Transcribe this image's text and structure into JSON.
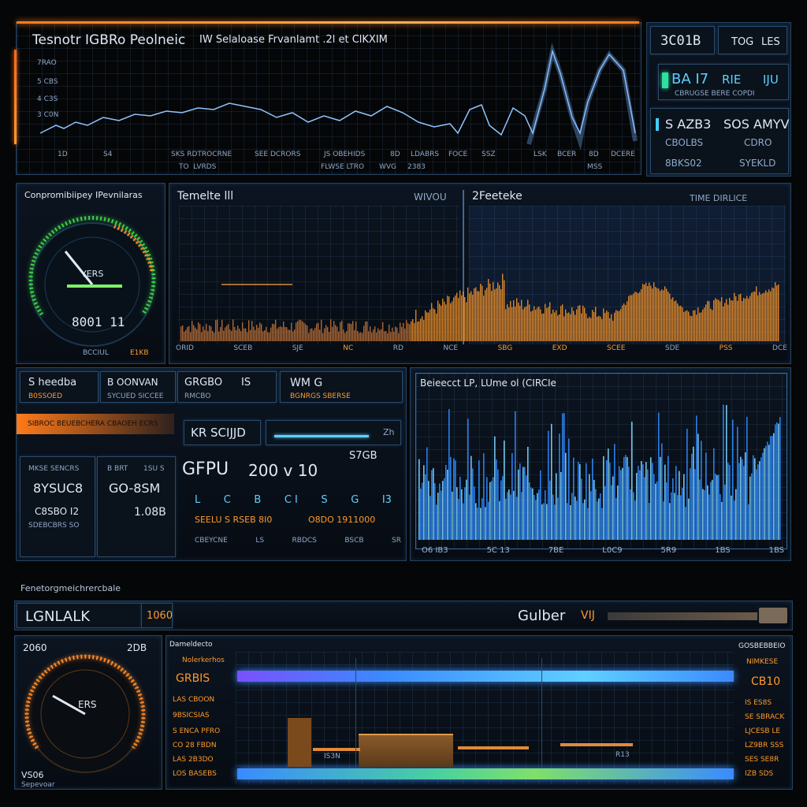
{
  "top": {
    "title": "Tesnotr IGBRo Peolneic",
    "title_tail": "IW Selaloase Frvanlamt .2l et ClKXIM",
    "y_labels": [
      "7RAO",
      "5 CBS",
      "4 C3S",
      "3 C0N"
    ],
    "x_labels": [
      "1D",
      "S4",
      "SKS RDTROCRNE",
      "SEE DCRORS",
      "JS OBEHIDS",
      "8D",
      "LDABRS",
      "FOCE",
      "SSZ",
      "LSK",
      "BCER",
      "8D",
      "DCERE"
    ],
    "x_sub": [
      "TO  LVRDS",
      "FLWSE LTRO",
      "WVG",
      "2383",
      "MSS"
    ],
    "series": [
      {
        "name": "baseline",
        "color": "#7fb8ff"
      },
      {
        "name": "peaks",
        "color": "#a8c8ff"
      }
    ]
  },
  "stats": {
    "a_value": "3C01B",
    "b_label": "TOG",
    "b_sub": "LES",
    "row2_a": "BA I7",
    "row2_b": "RIE",
    "row2_c": "IJU",
    "row2_sub": "CBRUGSE BERE COPDI",
    "row3_a": "S AZB3",
    "row3_b": "SOS AMYV",
    "row3_c": "CBOLBS",
    "row3_d": "CDRO",
    "row3_e": "8BKS02",
    "row3_f": "SYEKLD"
  },
  "gauge1": {
    "header": "Conpromibiipey IPevnilaras",
    "value": "8001 11",
    "inner": "YERS",
    "foot_a": "BCCIUL",
    "foot_b": "E1KB"
  },
  "chart_mid": {
    "left_title": "Temelte lll",
    "left_right": "WIVOU",
    "right_title": "2Feeteke",
    "right_right": "TIME DIRLICE",
    "x_labels": [
      "ORID",
      "SCEB",
      "SJE",
      "NC",
      "RD",
      "NCE",
      "SBG",
      "EXD",
      "SCEE",
      "SDE",
      "PSS",
      "DCE"
    ]
  },
  "gpu": {
    "tabs": [
      "S heedba",
      "B OONVAN",
      "GRGBO",
      "IS",
      "WM G"
    ],
    "tab_subs": [
      "B0SSOED",
      "SYCUED SICCEE",
      "RMCBO",
      "",
      "BGNRGS SBERSE"
    ],
    "strip_label": "SIBROC BEUEBCHERA CBAOEH ECRS",
    "search_value": "KR SCIJJD",
    "code": "S7GB",
    "col_a_title": "MKSE SENCRS",
    "col_a_value": "8YSUC8",
    "col_a_sub": "C8SBO I2",
    "col_a_sub2": "SDEBCBRS SO",
    "col_b_title": "B BRT",
    "col_b_title2": "1SU S",
    "col_b_value": "GO-8SM",
    "col_b_sub": "1.08B",
    "big_title": "GFPU",
    "big_value": "200 v 10",
    "row_a": [
      "L",
      "C",
      "B",
      "C I",
      "S",
      "G",
      "I3"
    ],
    "row_b": "SEELU S RSEB 8I0",
    "row_c": "O8DO 1911000",
    "foot": [
      "CBEYCNE",
      "LS",
      "RBDCS",
      "BSCB",
      "SR"
    ]
  },
  "freq": {
    "title": "Beieecct LP, LUme ol (CIRCIe",
    "x_labels": [
      "O6 IB3",
      "5C 13",
      "7BE",
      "L0C9",
      "5R9",
      "1BS",
      "1BS"
    ]
  },
  "bottom": {
    "section_label": "Fenetorgmeichrercbale",
    "tab_left": "LGNLALK",
    "tab_left_badge": "1060",
    "tab_right": "Gulber",
    "tab_right_mark": "VIJ",
    "gauge_top_left": "2060",
    "gauge_top_right": "2DB",
    "gauge_inner": "ERS",
    "gauge_b": "VS06",
    "gauge_b_sub": "Sepevoar",
    "left_list_head": "Dameldecto",
    "left_list_head2": "Nolerkerhos",
    "left_list_big": "GRBIS",
    "left_list": [
      "LAS CBOON",
      "9BSICSIAS",
      "S ENCA PFRO",
      "CO 28 FBDN",
      "LAS 2B3DO",
      "LOS BASEBS"
    ],
    "right_list_head": "GOSBEBBEIO",
    "right_list_head2": "NIMKESE",
    "right_list_big": "CB10",
    "right_list": [
      "IS ES8S",
      "SE SBRACK",
      "LJCESB LE",
      "LZ9BR SSS",
      "SES SE8R",
      "IZB SDS"
    ],
    "bar_mid_label": "IS3N",
    "bar_mid_label2": "R13"
  }
}
